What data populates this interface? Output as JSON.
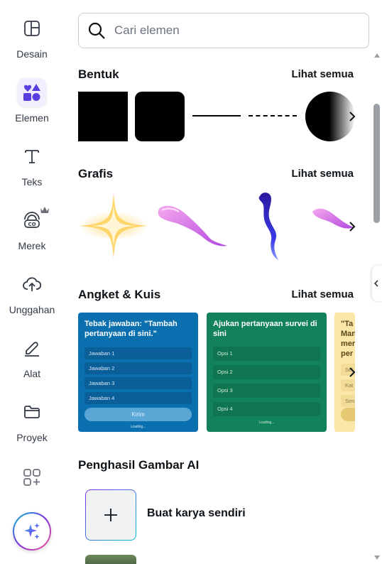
{
  "rail": {
    "items": [
      {
        "label": "Desain",
        "icon": "layout-icon"
      },
      {
        "label": "Elemen",
        "icon": "shapes-icon",
        "active": true
      },
      {
        "label": "Teks",
        "icon": "text-icon"
      },
      {
        "label": "Merek",
        "icon": "brand-icon"
      },
      {
        "label": "Unggahan",
        "icon": "upload-cloud-icon"
      },
      {
        "label": "Alat",
        "icon": "pen-tool-icon"
      },
      {
        "label": "Proyek",
        "icon": "folder-icon"
      }
    ]
  },
  "search": {
    "placeholder": "Cari elemen"
  },
  "sections": {
    "shapes": {
      "title": "Bentuk",
      "see_all": "Lihat semua"
    },
    "graphics": {
      "title": "Grafis",
      "see_all": "Lihat semua"
    },
    "quiz": {
      "title": "Angket & Kuis",
      "see_all": "Lihat semua"
    },
    "ai": {
      "title": "Penghasil Gambar AI",
      "create_label": "Buat karya sendiri"
    }
  },
  "quiz_cards": [
    {
      "title": "Tebak jawaban: \"Tambah pertanyaan di sini.\"",
      "options": [
        "Jawaban 1",
        "Jawaban 2",
        "Jawaban 3",
        "Jawaban 4"
      ],
      "submit": "Kirim",
      "loading": "Loading...",
      "color": "#0a6fae"
    },
    {
      "title": "Ajukan pertanyaan survei di sini",
      "options": [
        "Opsi 1",
        "Opsi 2",
        "Opsi 3",
        "Opsi 4"
      ],
      "loading": "Loading...",
      "color": "#12825a"
    },
    {
      "title": "\"Ta Man mer per",
      "options": [
        "Sel",
        "Kat",
        "Sen"
      ],
      "color": "#fbe7a8"
    }
  ],
  "colors": {
    "accent": "#7d2ae8",
    "text": "#0e1318"
  }
}
